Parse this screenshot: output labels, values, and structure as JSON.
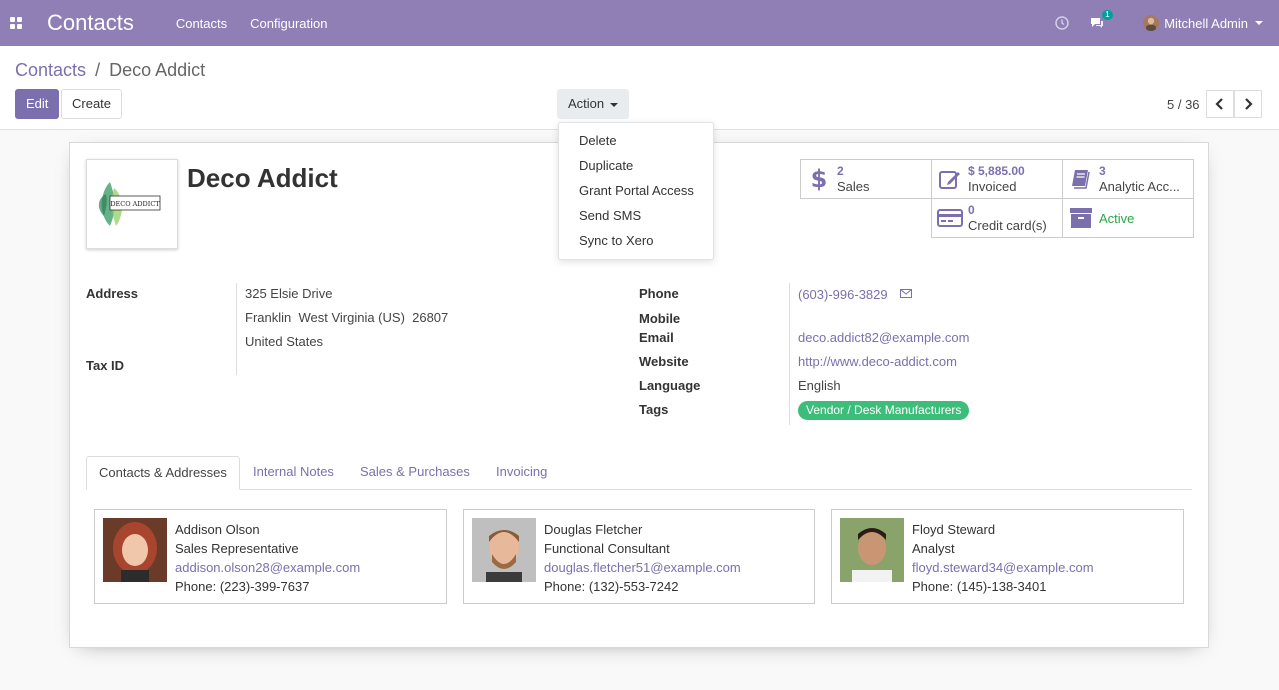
{
  "navbar": {
    "app_title": "Contacts",
    "menus": [
      "Contacts",
      "Configuration"
    ],
    "messages_count": "1",
    "user_name": "Mitchell Admin"
  },
  "breadcrumb": {
    "parent": "Contacts",
    "separator": "/",
    "current": "Deco Addict"
  },
  "toolbar": {
    "edit_label": "Edit",
    "create_label": "Create",
    "action_label": "Action"
  },
  "pager": {
    "value": "5 / 36"
  },
  "action_menu": {
    "items": [
      "Delete",
      "Duplicate",
      "Grant Portal Access",
      "Send SMS",
      "Sync to Xero"
    ]
  },
  "partner": {
    "name": "Deco Addict",
    "logo_text": "DECO ADDICT"
  },
  "stats": {
    "sales": {
      "value": "2",
      "label": "Sales"
    },
    "invoiced": {
      "value": "$ 5,885.00",
      "label": "Invoiced"
    },
    "analytic": {
      "value": "3",
      "label": "Analytic Acc..."
    },
    "credit": {
      "value": "0",
      "label": "Credit card(s)"
    },
    "active": {
      "label": "Active"
    }
  },
  "fields": {
    "address_label": "Address",
    "street": "325 Elsie Drive",
    "city_line": "Franklin  West Virginia (US)  26807",
    "country": "United States",
    "tax_label": "Tax ID",
    "phone_label": "Phone",
    "phone": "(603)-996-3829",
    "mobile_label": "Mobile",
    "email_label": "Email",
    "email": "deco.addict82@example.com",
    "website_label": "Website",
    "website": "http://www.deco-addict.com",
    "language_label": "Language",
    "language": "English",
    "tags_label": "Tags",
    "tag": "Vendor / Desk Manufacturers"
  },
  "tabs": [
    "Contacts & Addresses",
    "Internal Notes",
    "Sales & Purchases",
    "Invoicing"
  ],
  "contacts": [
    {
      "name": "Addison Olson",
      "role": "Sales Representative",
      "email": "addison.olson28@example.com",
      "phone": "Phone: (223)-399-7637"
    },
    {
      "name": "Douglas Fletcher",
      "role": "Functional Consultant",
      "email": "douglas.fletcher51@example.com",
      "phone": "Phone: (132)-553-7242"
    },
    {
      "name": "Floyd Steward",
      "role": "Analyst",
      "email": "floyd.steward34@example.com",
      "phone": "Phone: (145)-138-3401"
    }
  ],
  "icons": {
    "apps": "apps-grid-icon",
    "clock": "clock-icon",
    "chat": "chat-icon",
    "dollar": "dollar-icon",
    "edit": "pencil-icon",
    "book": "book-icon",
    "card": "credit-card-icon",
    "archive": "archive-icon",
    "envelope": "envelope-icon"
  },
  "colors": {
    "brand": "#8f7fb5",
    "link": "#7c6fad",
    "tag": "#3dbd7a",
    "active": "#28a745"
  }
}
